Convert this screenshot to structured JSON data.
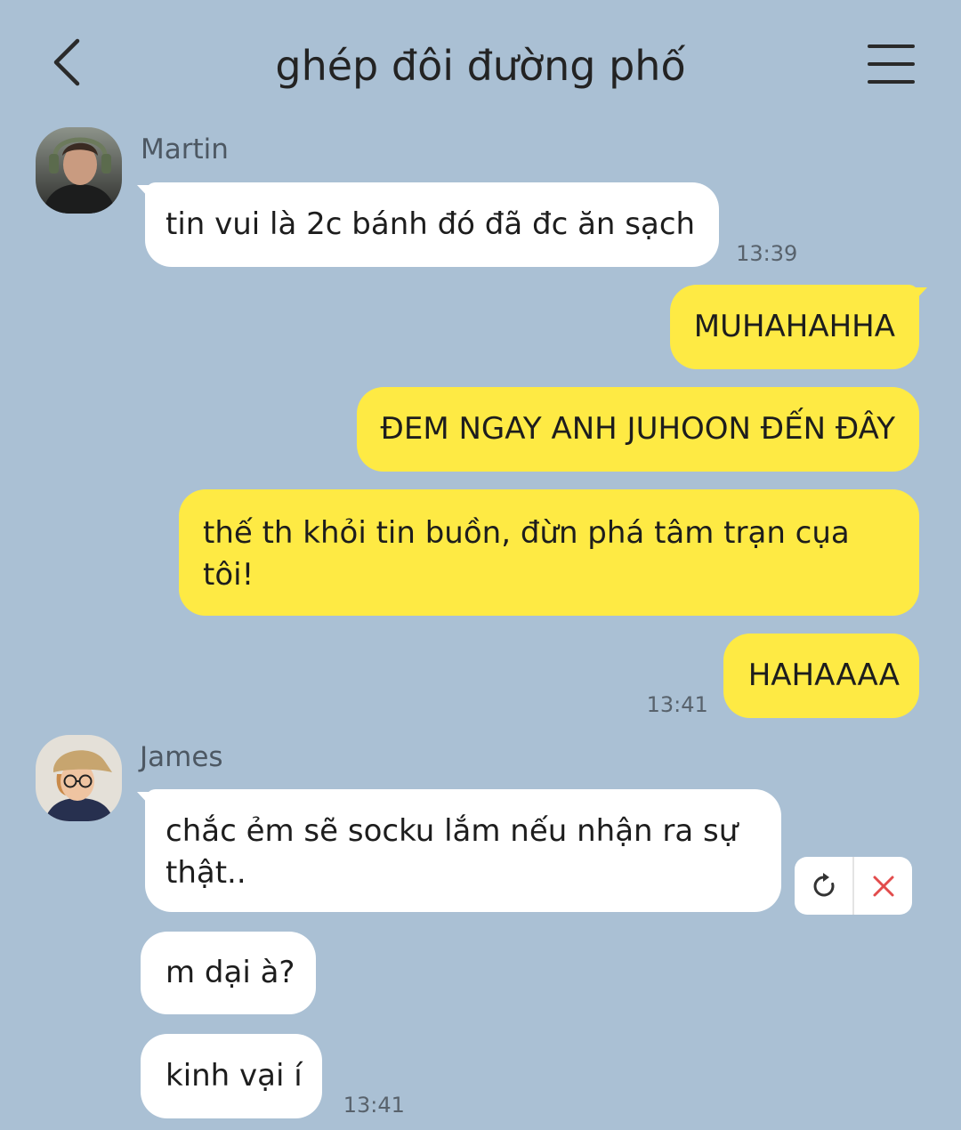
{
  "header": {
    "title": "ghép đôi đường phố",
    "back_icon": "chevron-left-icon",
    "menu_icon": "hamburger-menu-icon"
  },
  "colors": {
    "background": "#aac0d4",
    "incoming_bubble": "#ffffff",
    "outgoing_bubble": "#feea44",
    "message_text": "#1d1d1d",
    "title_text": "#232323",
    "sender_name": "#4d5863",
    "timestamp": "#58626c",
    "cancel_icon": "#e24c4c"
  },
  "conversation": [
    {
      "sender": "Martin",
      "messages": [
        "tin vui là 2c bánh đó đã đc ăn sạch"
      ],
      "time": "13:39"
    },
    {
      "messages": [
        "MUHAHAHHA",
        "ĐEM NGAY ANH JUHOON ĐẾN ĐÂY",
        "thế th khỏi tin buồn, đừn phá tâm trạn cụa tôi!",
        "HAHAAAA"
      ],
      "time": "13:41"
    },
    {
      "sender": "James",
      "messages": [
        "chắc ẻm sẽ socku lắm nếu nhận ra sự thật..",
        "m dại à?",
        "kinh vại í"
      ],
      "time": "13:41"
    }
  ],
  "failed_message_actions": {
    "retry_icon": "refresh-icon",
    "delete_icon": "close-icon"
  }
}
